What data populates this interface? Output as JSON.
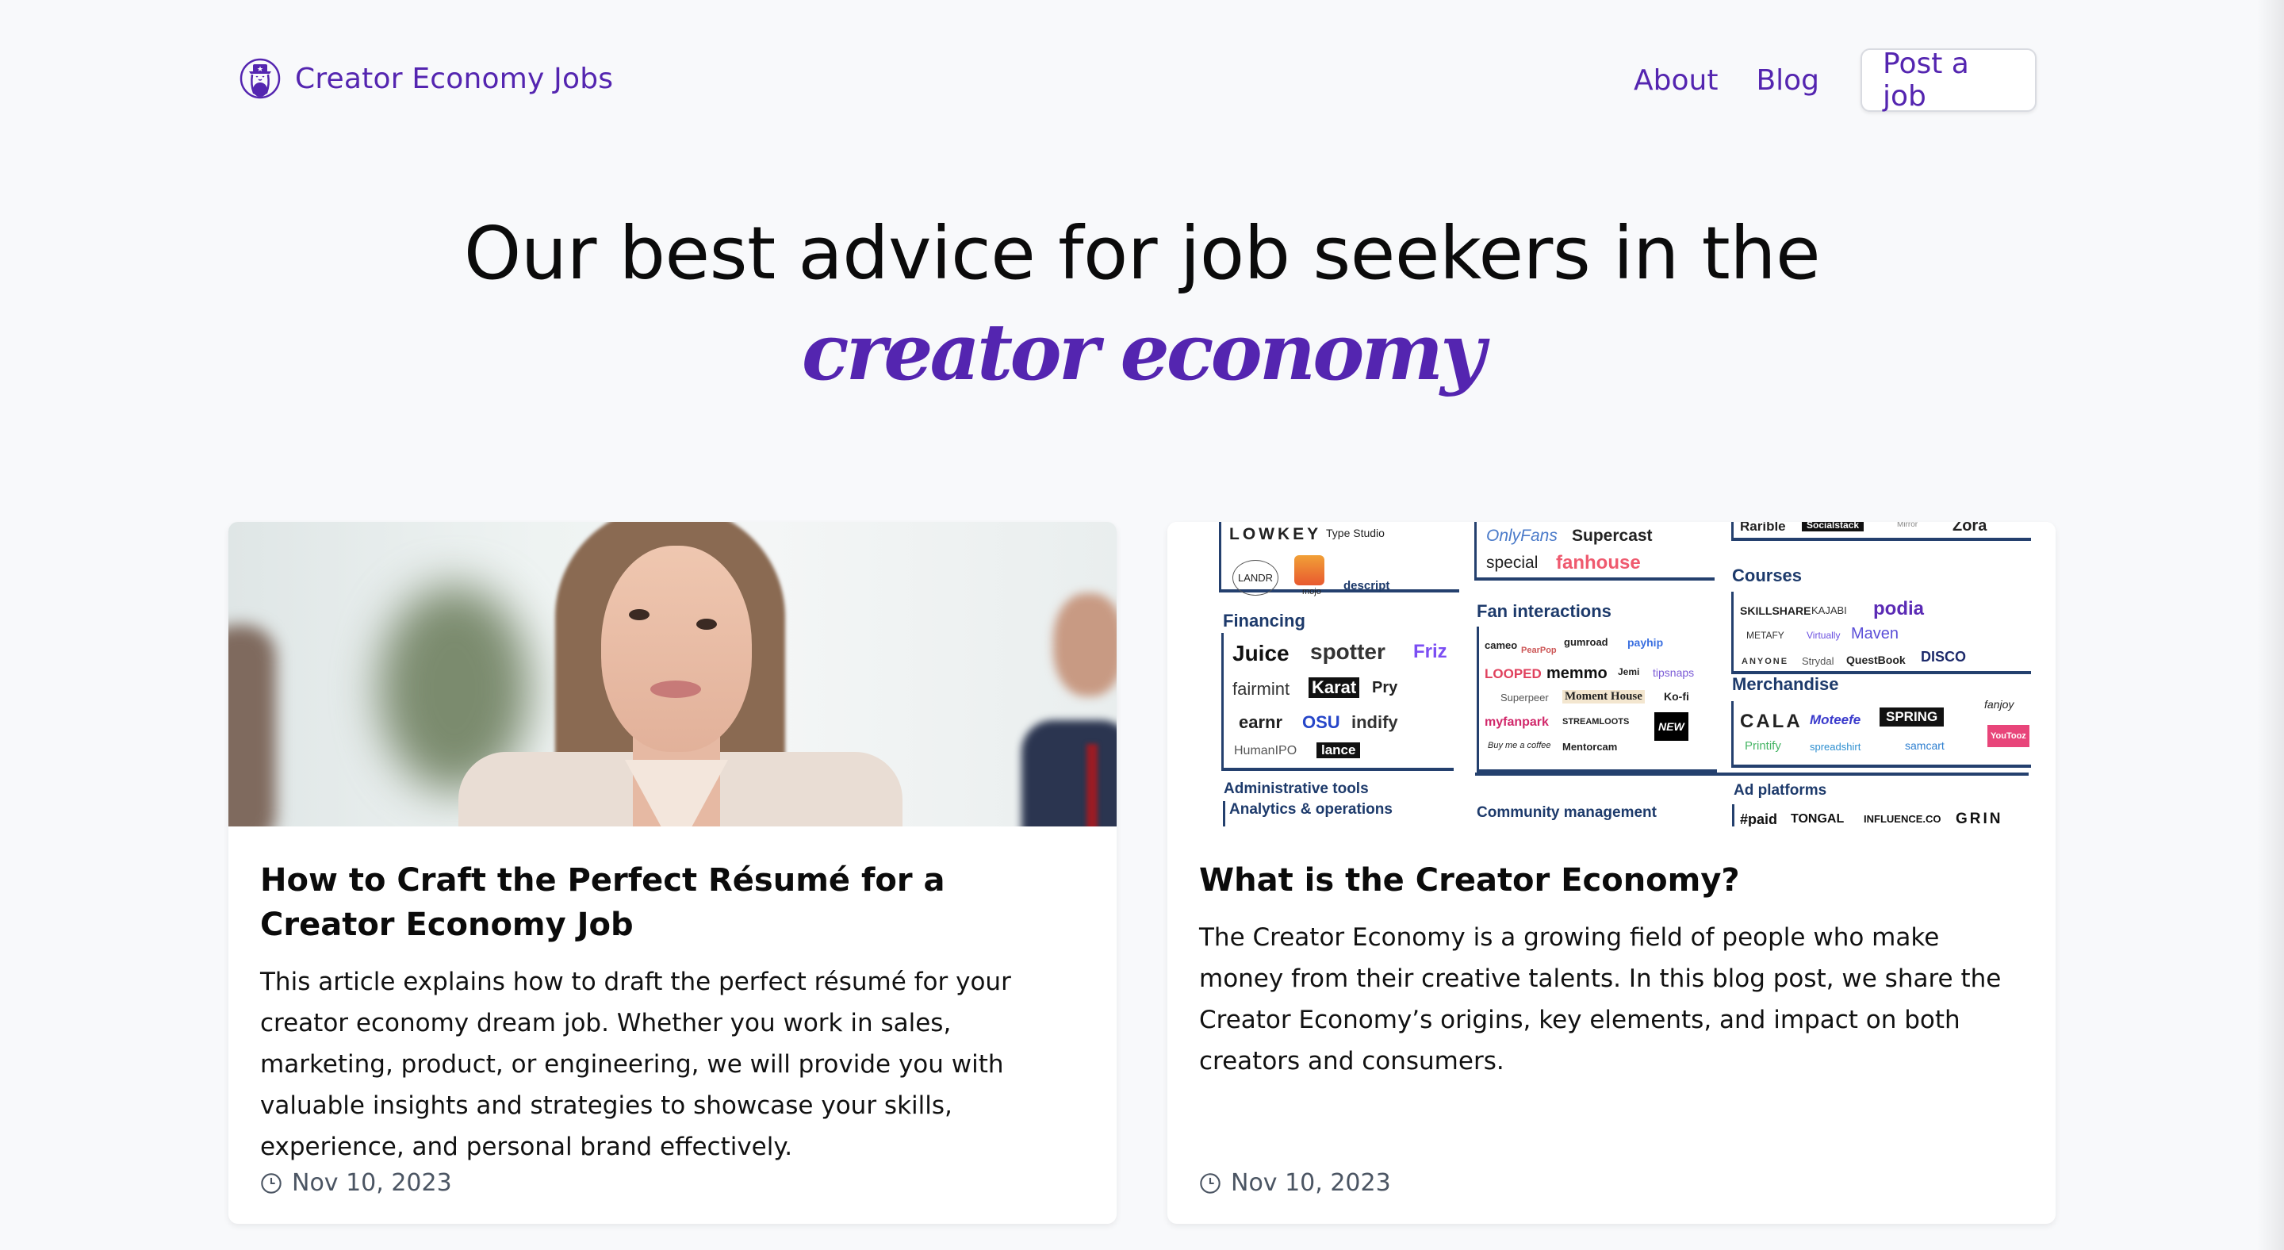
{
  "header": {
    "brand_name": "Creator Economy Jobs",
    "brand_icon": "cowboy-mascot-icon",
    "nav": {
      "about": "About",
      "blog": "Blog",
      "post_job": "Post a job"
    }
  },
  "hero": {
    "line1": "Our best advice for job seekers in the",
    "line2": "creator economy"
  },
  "colors": {
    "brand": "#5425b0",
    "background": "#f8f9fb",
    "date_text": "#4b5563"
  },
  "posts": [
    {
      "image_alt": "Smiling professional woman in a beige blazer in an office",
      "title": "How to Craft the Perfect Résumé for a Creator Economy Job",
      "description": "This article explains how to draft the perfect résumé for your creator economy dream job. Whether you work in sales, marketing, product, or engineering, we will provide you with valuable insights and strategies to showcase your skills, experience, and personal brand effectively.",
      "date": "Nov 10, 2023"
    },
    {
      "image_alt": "Creator economy market map of companies by category",
      "title": "What is the Creator Economy?",
      "description": "The Creator Economy is a growing field of people who make money from their creative talents. In this blog post, we share the Creator Economy’s origins, key elements, and impact on both creators and consumers.",
      "date": "Nov 10, 2023"
    }
  ],
  "market_map": {
    "headings": {
      "financing": "Financing",
      "fan_interactions": "Fan interactions",
      "courses": "Courses",
      "merchandise": "Merchandise",
      "administrative_tools": "Administrative tools",
      "analytics_operations": "Analytics & operations",
      "community_management": "Community management",
      "ad_platforms": "Ad platforms"
    },
    "logos": {
      "creation_tools": [
        "LOWKEY",
        "Type Studio",
        "LANDR",
        "mojo",
        "descript"
      ],
      "fan_top": [
        "OnlyFans",
        "Supercast",
        "special",
        "fanhouse"
      ],
      "web3": [
        "Rarible",
        "Socialstack",
        "Mirror",
        "Zora"
      ],
      "financing": [
        "Juice",
        "spotter",
        "Friz",
        "fairmint",
        "Karat",
        "Pry",
        "earnr",
        "OSU",
        "indify",
        "HumanIPO",
        "lance"
      ],
      "fan_interactions": [
        "cameo",
        "PearPop",
        "gumroad",
        "payhip",
        "LOOPED",
        "memmo",
        "Jemi",
        "tipsnaps",
        "Superpeer",
        "Moment House",
        "Ko-fi",
        "myfanpark",
        "STREAMLOOTS",
        "NEW",
        "Buy me a coffee",
        "Mentorcam"
      ],
      "courses": [
        "SKILLSHARE",
        "KAJABI",
        "podia",
        "METAFY",
        "Virtually",
        "Maven",
        "ANYONE",
        "Strydal",
        "QuestBook",
        "DISCO"
      ],
      "merchandise": [
        "CALA",
        "Moteefe",
        "SPRING",
        "fanjoy",
        "Printify",
        "spreadshirt",
        "samcart",
        "YouTooz"
      ],
      "ad_platforms": [
        "#paid",
        "TONGAL",
        "INFLUENCE.CO",
        "GRIN"
      ]
    }
  }
}
